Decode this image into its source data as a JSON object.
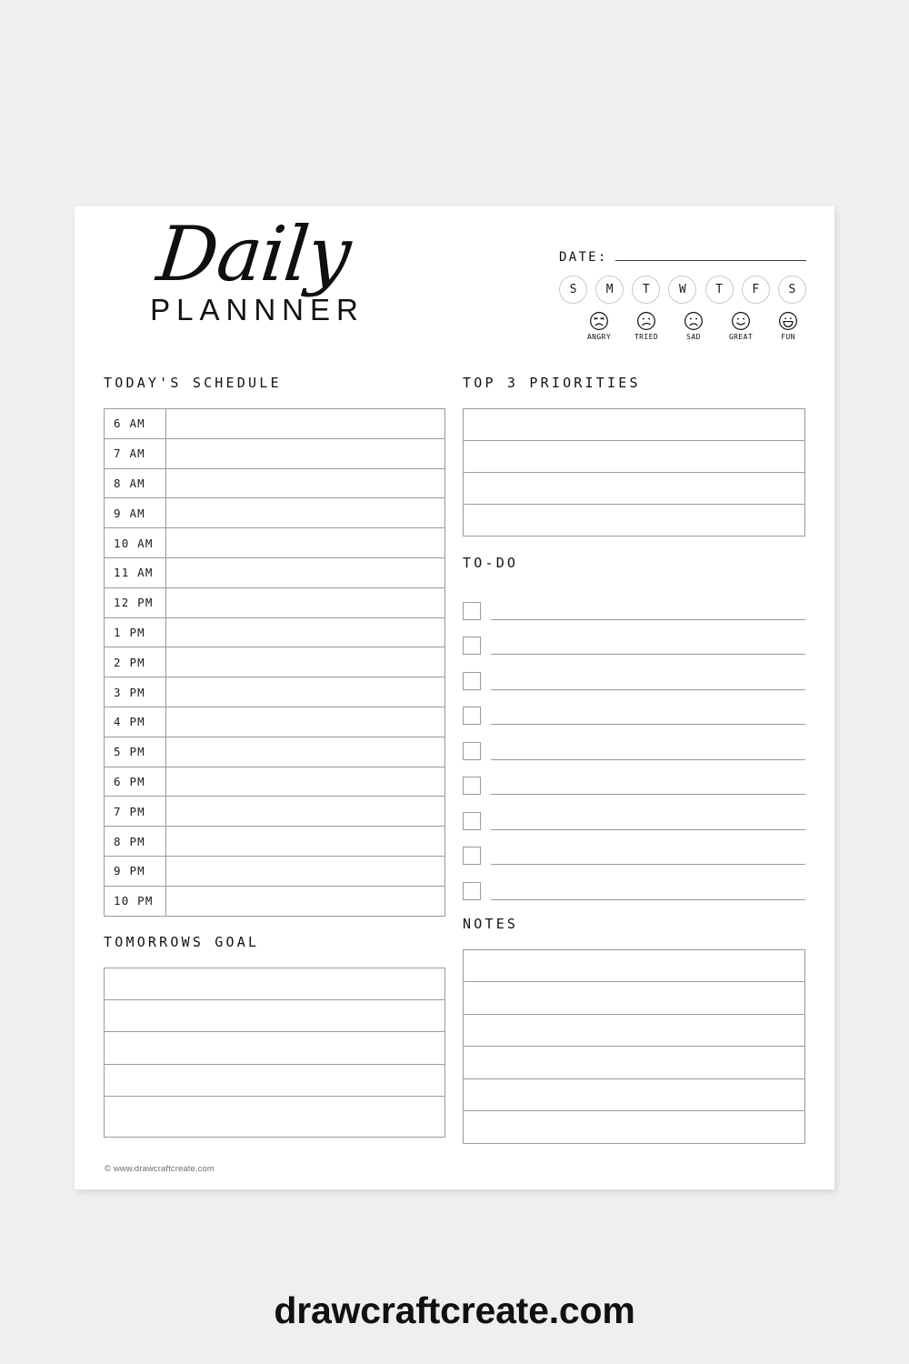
{
  "background_color": "#efeff0",
  "paper_color": "#ffffff",
  "header": {
    "title_script": "Daily",
    "title_sub": "PLANNNER",
    "date_label": "DATE:",
    "days": [
      "S",
      "M",
      "T",
      "W",
      "T",
      "F",
      "S"
    ],
    "moods": [
      {
        "icon": "angry-face-icon",
        "label": "ANGRY"
      },
      {
        "icon": "tired-face-icon",
        "label": "TRIED"
      },
      {
        "icon": "sad-face-icon",
        "label": "SAD"
      },
      {
        "icon": "great-face-icon",
        "label": "GREAT"
      },
      {
        "icon": "fun-face-icon",
        "label": "FUN"
      }
    ]
  },
  "schedule": {
    "title": "TODAY'S SCHEDULE",
    "times": [
      "6 AM",
      "7 AM",
      "8 AM",
      "9 AM",
      "10 AM",
      "11 AM",
      "12 PM",
      "1 PM",
      "2 PM",
      "3 PM",
      "4 PM",
      "5 PM",
      "6 PM",
      "7 PM",
      "8 PM",
      "9 PM",
      "10 PM"
    ]
  },
  "priorities": {
    "title": "TOP 3 PRIORITIES",
    "row_count": 4
  },
  "todo": {
    "title": "TO-DO",
    "item_count": 9
  },
  "goal": {
    "title": "TOMORROWS GOAL",
    "row_count": 5
  },
  "notes": {
    "title": "NOTES",
    "row_count": 6
  },
  "credit": "© www.drawcraftcreate.com",
  "wordmark": "drawcraftcreate.com"
}
